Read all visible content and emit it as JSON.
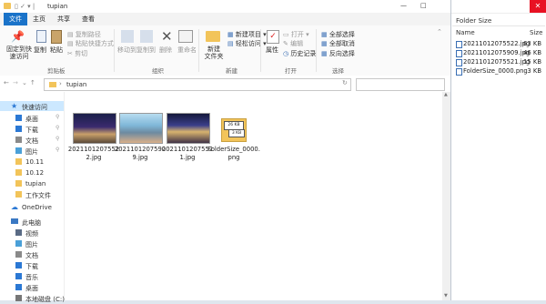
{
  "explorer": {
    "title": "tupian",
    "menu_tabs": [
      "文件",
      "主页",
      "共享",
      "查看"
    ],
    "ribbon": {
      "clipboard": {
        "label": "剪贴板",
        "pin": "固定到快\n速访问",
        "copy": "复制",
        "paste": "粘贴",
        "copy_path": "复制路径",
        "paste_shortcut": "粘贴快捷方式",
        "cut": "剪切"
      },
      "organize": {
        "label": "组织",
        "move_to": "移动到",
        "copy_to": "复制到",
        "delete": "删除",
        "rename": "重命名"
      },
      "new": {
        "label": "新建",
        "new_folder": "新建\n文件夹",
        "new_item": "新建项目",
        "easy_access": "轻松访问"
      },
      "open": {
        "label": "打开",
        "properties": "属性",
        "open": "打开",
        "edit": "编辑",
        "history": "历史记录"
      },
      "select": {
        "label": "选择",
        "select_all": "全部选择",
        "select_none": "全部取消",
        "invert": "反向选择"
      }
    },
    "address": "tupian",
    "nav": {
      "quick_access": "快速访问",
      "quick_items": [
        "桌面",
        "下载",
        "文档",
        "图片",
        "10.11",
        "10.12",
        "tupian",
        "工作文件"
      ],
      "onedrive": "OneDrive",
      "this_pc": "此电脑",
      "pc_items": [
        "视频",
        "图片",
        "文档",
        "下载",
        "音乐",
        "桌面",
        "本地磁盘 (C:)"
      ]
    },
    "files": [
      {
        "name": "20211012075522.jpg"
      },
      {
        "name": "20211012075909.jpg"
      },
      {
        "name": "20211012075521.jpg"
      },
      {
        "name": "FolderSize_0000.png"
      }
    ],
    "foldersize_icon_text": [
      "26 KB",
      "3 KB"
    ]
  },
  "folder_size": {
    "title": "Folder Size",
    "columns": [
      "Name",
      "Size"
    ],
    "rows": [
      {
        "name": "20211012075522.jpg",
        "size": "63 KB"
      },
      {
        "name": "20211012075909.jpg",
        "size": "46 KB"
      },
      {
        "name": "20211012075521.jpg",
        "size": "15 KB"
      },
      {
        "name": "FolderSize_0000.png",
        "size": "3 KB"
      }
    ],
    "close_glyph": "✕"
  },
  "colors": {
    "accent": "#1a73c9",
    "folder": "#f2c45a",
    "close": "#e81123"
  }
}
